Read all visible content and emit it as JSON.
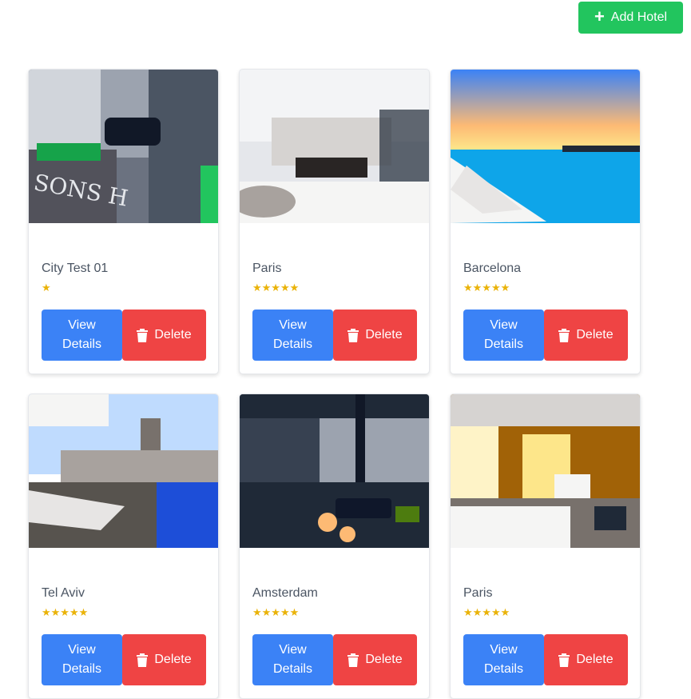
{
  "toolbar": {
    "add_label": "Add Hotel",
    "add_icon": "plus-icon"
  },
  "actions": {
    "view_label": "View Details",
    "delete_label": "Delete",
    "delete_icon": "trash-icon"
  },
  "colors": {
    "add": "#22c55e",
    "view": "#3b82f6",
    "delete": "#ef4444",
    "star": "#eab308"
  },
  "hotels": [
    {
      "city": "City Test 01",
      "stars": "★",
      "rating": 1
    },
    {
      "city": "Paris",
      "stars": "★★★★★",
      "rating": 5
    },
    {
      "city": "Barcelona",
      "stars": "★★★★★",
      "rating": 5
    },
    {
      "city": "Tel Aviv",
      "stars": "★★★★★",
      "rating": 5
    },
    {
      "city": "Amsterdam",
      "stars": "★★★★★",
      "rating": 5
    },
    {
      "city": "Paris",
      "stars": "★★★★★",
      "rating": 5
    }
  ]
}
